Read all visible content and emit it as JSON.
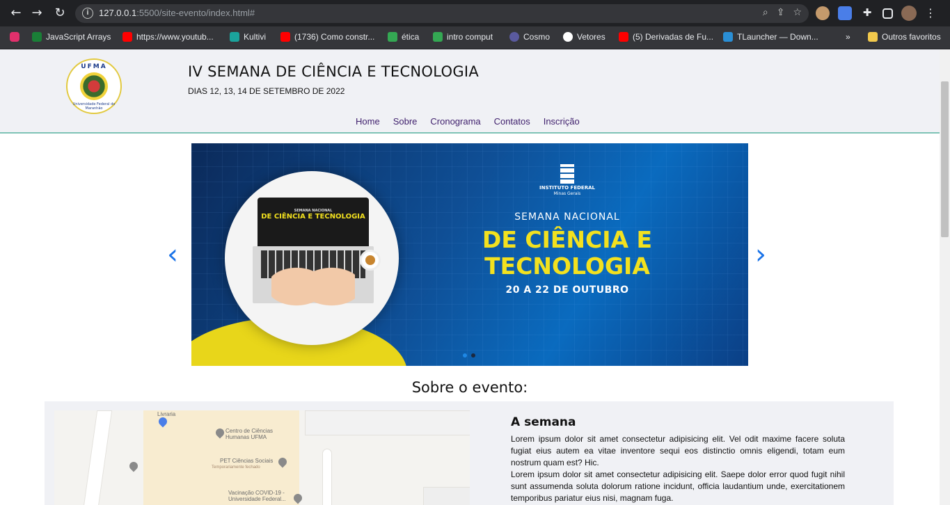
{
  "browser": {
    "url_host": "127.0.0.1",
    "url_rest": ":5500/site-evento/index.html#",
    "bookmarks": [
      {
        "label": "",
        "color": "#e1306c"
      },
      {
        "label": "JavaScript Arrays",
        "color": "#1a7f37"
      },
      {
        "label": "https://www.youtub...",
        "color": "#ff0000"
      },
      {
        "label": "Kultivi",
        "color": "#1ba39c"
      },
      {
        "label": "(1736) Como constr...",
        "color": "#ff0000"
      },
      {
        "label": "ética",
        "color": "#34a853"
      },
      {
        "label": "intro comput",
        "color": "#34a853"
      },
      {
        "label": "Cosmo",
        "color": "#5a5a9e"
      },
      {
        "label": "Vetores",
        "color": "#ffffff"
      },
      {
        "label": "(5) Derivadas de Fu...",
        "color": "#ff0000"
      },
      {
        "label": "TLauncher — Down...",
        "color": "#2a8fd6"
      }
    ],
    "more_label": "»",
    "other_favorites": "Outros favoritos"
  },
  "header": {
    "logo_top": "UFMA",
    "logo_bottom": "Universidade Federal do Maranhão",
    "title": "IV SEMANA DE CIÊNCIA E TECNOLOGIA",
    "date": "DIAS 12, 13, 14 DE SETEMBRO DE 2022",
    "menu": [
      "Home",
      "Sobre",
      "Cronograma",
      "Contatos",
      "Inscrição"
    ]
  },
  "banner": {
    "screen_small": "SEMANA NACIONAL",
    "screen_big": "DE CIÊNCIA E TECNOLOGIA",
    "institute": "INSTITUTO FEDERAL",
    "institute_sub": "Minas Gerais",
    "subtitle": "SEMANA NACIONAL",
    "main": "DE CIÊNCIA E TECNOLOGIA",
    "dates": "20 A 22 DE OUTUBRO",
    "slide_count": 2,
    "active_slide": 1
  },
  "about": {
    "section_title": "Sobre o evento:",
    "heading": "A semana",
    "p1": "Lorem ipsum dolor sit amet consectetur adipisicing elit. Vel odit maxime facere soluta fugiat eius autem ea vitae inventore sequi eos distinctio omnis eligendi, totam eum nostrum quam est? Hic.",
    "p2": "Lorem ipsum dolor sit amet consectetur adipisicing elit. Saepe dolor error quod fugit nihil sunt assumenda soluta dolorum ratione incidunt, officia laudantium unde, exercitationem temporibus pariatur eius nisi, magnam fuga.",
    "map_labels": {
      "centro": "Centro de Ciências Humanas UFMA",
      "pet": "PET Ciências Sociais",
      "pet_sub": "Temporariamente fechado",
      "vacina": "Vacinação COVID-19 - Universidade Federal...",
      "livraria": "Livraria"
    }
  }
}
